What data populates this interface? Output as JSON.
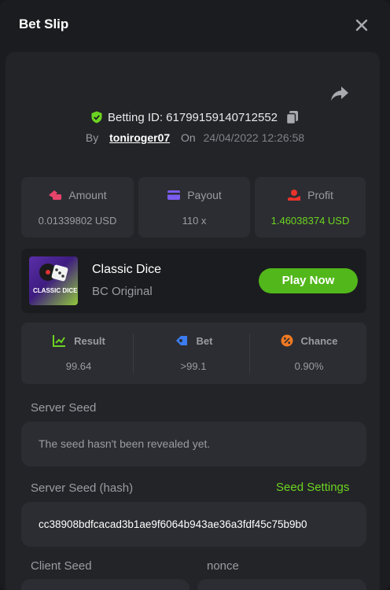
{
  "header": {
    "title": "Bet Slip"
  },
  "bet": {
    "id_text": "Betting ID: 61799159140712552",
    "by": "By",
    "user": "toniroger07",
    "on": "On",
    "date": "24/04/2022 12:26:58"
  },
  "stats": [
    {
      "label": "Amount",
      "value": "0.01339802 USD",
      "icon": "amount-icon"
    },
    {
      "label": "Payout",
      "value": "110 x",
      "icon": "payout-icon"
    },
    {
      "label": "Profit",
      "value": "1.46038374 USD",
      "icon": "profit-icon"
    }
  ],
  "game": {
    "name": "Classic Dice",
    "provider": "BC Original",
    "play_label": "Play Now",
    "thumb_text": "CLASSIC DICE"
  },
  "result": [
    {
      "label": "Result",
      "value": "99.64"
    },
    {
      "label": "Bet",
      "value": ">99.1"
    },
    {
      "label": "Chance",
      "value": "0.90%"
    }
  ],
  "seeds": {
    "server_seed_label": "Server Seed",
    "server_seed_value": "The seed hasn't been revealed yet.",
    "server_hash_label": "Server Seed (hash)",
    "seed_settings": "Seed Settings",
    "server_hash_value": "cc38908bdfcacad3b1ae9f6064b943ae36a3fdf45c75b9b0",
    "client_seed_label": "Client Seed",
    "nonce_label": "nonce"
  },
  "colors": {
    "accent": "#6cd421",
    "button": "#52b71a",
    "amount_icon": "#e8446a",
    "payout_icon": "#7b5cf0",
    "profit_icon": "#e8332b",
    "result_icon": "#6cd421",
    "bet_icon": "#3b7cf0",
    "chance_icon": "#f07a22"
  }
}
